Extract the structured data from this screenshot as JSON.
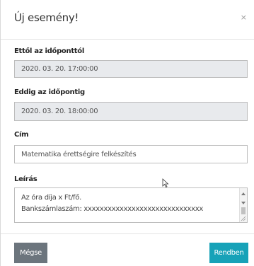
{
  "dialog": {
    "title": "Új esemény!",
    "close_glyph": "×"
  },
  "form": {
    "start": {
      "label": "Ettől az időponttól",
      "value": "2020. 03. 20. 17:00:00"
    },
    "end": {
      "label": "Eddig az időpontig",
      "value": "2020. 03. 20. 18:00:00"
    },
    "title_field": {
      "label": "Cím",
      "value": "Matematika érettségire felkészítés"
    },
    "description": {
      "label": "Leírás",
      "lines": [
        "Az óra díja x Ft/fő.",
        "Bankszámlaszám: xxxxxxxxxxxxxxxxxxxxxxxxxxxxxx"
      ]
    }
  },
  "footer": {
    "cancel_label": "Mégse",
    "ok_label": "Rendben"
  },
  "colors": {
    "cancel_button": "#6c757d",
    "ok_button": "#17a2b8",
    "disabled_field": "#e8eaed"
  },
  "icons": {
    "close": "close-icon",
    "cursor": "mouse-pointer-icon",
    "resize": "resize-grip-icon"
  }
}
